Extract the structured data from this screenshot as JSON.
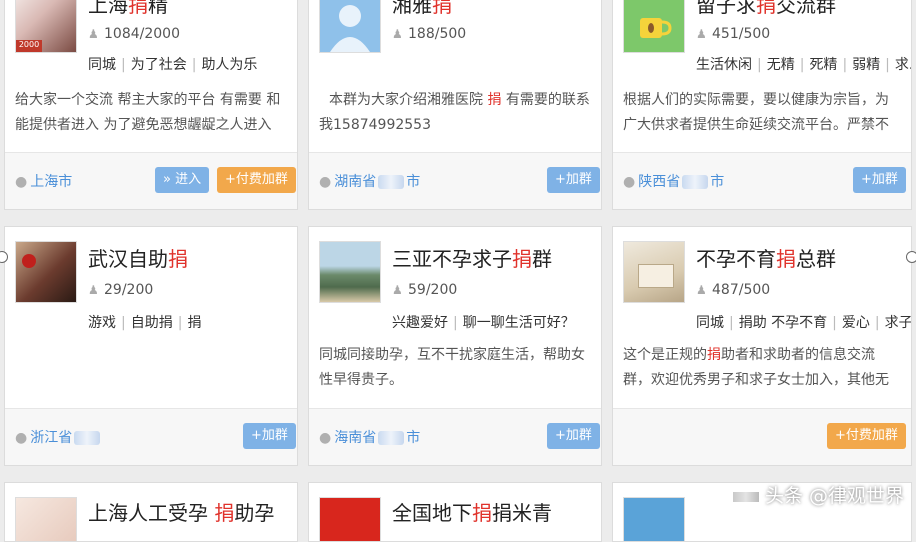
{
  "row1": [
    {
      "title_pre": "上海",
      "title_hl": "捐",
      "title_post": "精",
      "members": "1084/2000",
      "tags": [
        "同城",
        "为了社会",
        "助人为乐"
      ],
      "desc": "给大家一个交流 帮主大家的平台 有需要 和 能提供者进入 为了避免恶想龌龊之人进入 需要门票 ...",
      "location": "上海市",
      "buttons": [
        "» 进入",
        "+付费加群"
      ]
    },
    {
      "title_pre": "湘雅",
      "title_hl": "捐",
      "title_post": "",
      "members": "188/500",
      "tags": [],
      "desc_pre": "本群为大家介绍湘雅医院 ",
      "desc_hl": "捐",
      "desc_post": " 有需要的联系我15874992553",
      "location": "湖南省",
      "location_suffix": "市",
      "buttons": [
        "+加群"
      ]
    },
    {
      "title_pre": "留子求",
      "title_hl": "捐",
      "title_post": "交流群",
      "members": "451/500",
      "tags": [
        "生活休闲",
        "无精",
        "死精",
        "弱精",
        "求..."
      ],
      "desc": "根据人们的实际需要，要以健康为宗旨，为广大供求者提供生命延续交流平台。严禁不文明用语,不...",
      "location": "陕西省",
      "location_suffix": "市",
      "buttons": [
        "+加群"
      ]
    }
  ],
  "row2": [
    {
      "title_pre": "武汉自助",
      "title_hl": "捐",
      "title_post": "",
      "members": "29/200",
      "tags": [
        "游戏",
        "自助捐",
        "捐"
      ],
      "desc": "",
      "location": "浙江省",
      "buttons": [
        "+加群"
      ]
    },
    {
      "title_pre": "三亚不孕求子",
      "title_hl": "捐",
      "title_post": "群",
      "members": "59/200",
      "tags": [
        "兴趣爱好",
        "聊一聊生活可好？"
      ],
      "desc": "同城同接助孕，互不干扰家庭生活，帮助女性早得贵子。",
      "location": "海南省",
      "location_suffix": "市",
      "buttons": [
        "+加群"
      ]
    },
    {
      "title_pre": "不孕不育",
      "title_hl": "捐",
      "title_post": "总群",
      "members": "487/500",
      "tags": [
        "同城",
        "捐助 不孕不育",
        "爱心",
        "求子..."
      ],
      "desc_pre": "这个是正规的",
      "desc_hl": "捐",
      "desc_post": "助者和求助者的信息交流群，欢迎优秀男子和求子女士加入，其他无聊广告勿加，...",
      "location": "",
      "buttons": [
        "+付费加群"
      ]
    }
  ],
  "row3": [
    {
      "title_pre": "上海人工受孕 ",
      "title_hl": "捐",
      "title_post": "助孕"
    },
    {
      "title_pre": "全国地下",
      "title_hl": "捐",
      "title_post": "捐米青"
    },
    {
      "title_pre": "",
      "title_hl": "",
      "title_post": ""
    }
  ],
  "watermark": "头条 @律观世界",
  "colors": {
    "highlight": "#e0322b",
    "btn_blue": "#7fb2e6",
    "btn_orange": "#f2a84b",
    "location": "#4a8fd8"
  }
}
